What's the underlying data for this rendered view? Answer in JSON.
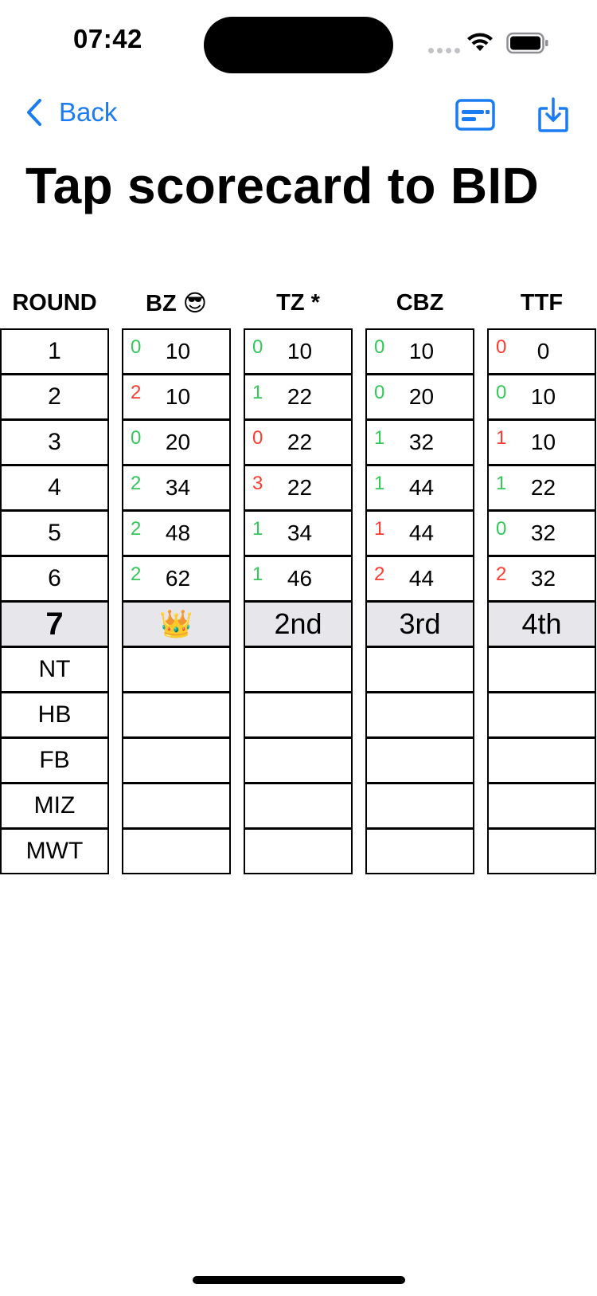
{
  "status_bar": {
    "time": "07:42"
  },
  "nav": {
    "back_label": "Back",
    "back_icon": "chevron-left-icon",
    "card_icon": "card-icon",
    "share_icon": "download-tray-icon",
    "accent_color": "#1a7cf2"
  },
  "title": "Tap scorecard to BID",
  "scorecard": {
    "round_header": "ROUND",
    "rounds": [
      "1",
      "2",
      "3",
      "4",
      "5",
      "6",
      "7",
      "NT",
      "HB",
      "FB",
      "MIZ",
      "MWT"
    ],
    "current_round": "7",
    "players": [
      {
        "name": "BZ 😎",
        "bids": [
          "0",
          "2",
          "0",
          "2",
          "2",
          "2"
        ],
        "bid_status": [
          "green",
          "red",
          "green",
          "green",
          "green",
          "green"
        ],
        "scores": [
          "10",
          "10",
          "20",
          "34",
          "48",
          "62"
        ],
        "current": "👑"
      },
      {
        "name": "TZ *",
        "bids": [
          "0",
          "1",
          "0",
          "3",
          "1",
          "1"
        ],
        "bid_status": [
          "green",
          "green",
          "red",
          "red",
          "green",
          "green"
        ],
        "scores": [
          "10",
          "22",
          "22",
          "22",
          "34",
          "46"
        ],
        "current": "2nd"
      },
      {
        "name": "CBZ",
        "bids": [
          "0",
          "0",
          "1",
          "1",
          "1",
          "2"
        ],
        "bid_status": [
          "green",
          "green",
          "green",
          "green",
          "red",
          "red"
        ],
        "scores": [
          "10",
          "20",
          "32",
          "44",
          "44",
          "44"
        ],
        "current": "3rd"
      },
      {
        "name": "TTF",
        "bids": [
          "0",
          "0",
          "1",
          "1",
          "0",
          "2"
        ],
        "bid_status": [
          "red",
          "green",
          "red",
          "green",
          "green",
          "red"
        ],
        "scores": [
          "0",
          "10",
          "10",
          "22",
          "32",
          "32"
        ],
        "current": "4th"
      }
    ],
    "colors": {
      "made_bid": "#34c759",
      "missed_bid": "#ff3b30",
      "current_row_bg": "#e6e6eb"
    }
  }
}
